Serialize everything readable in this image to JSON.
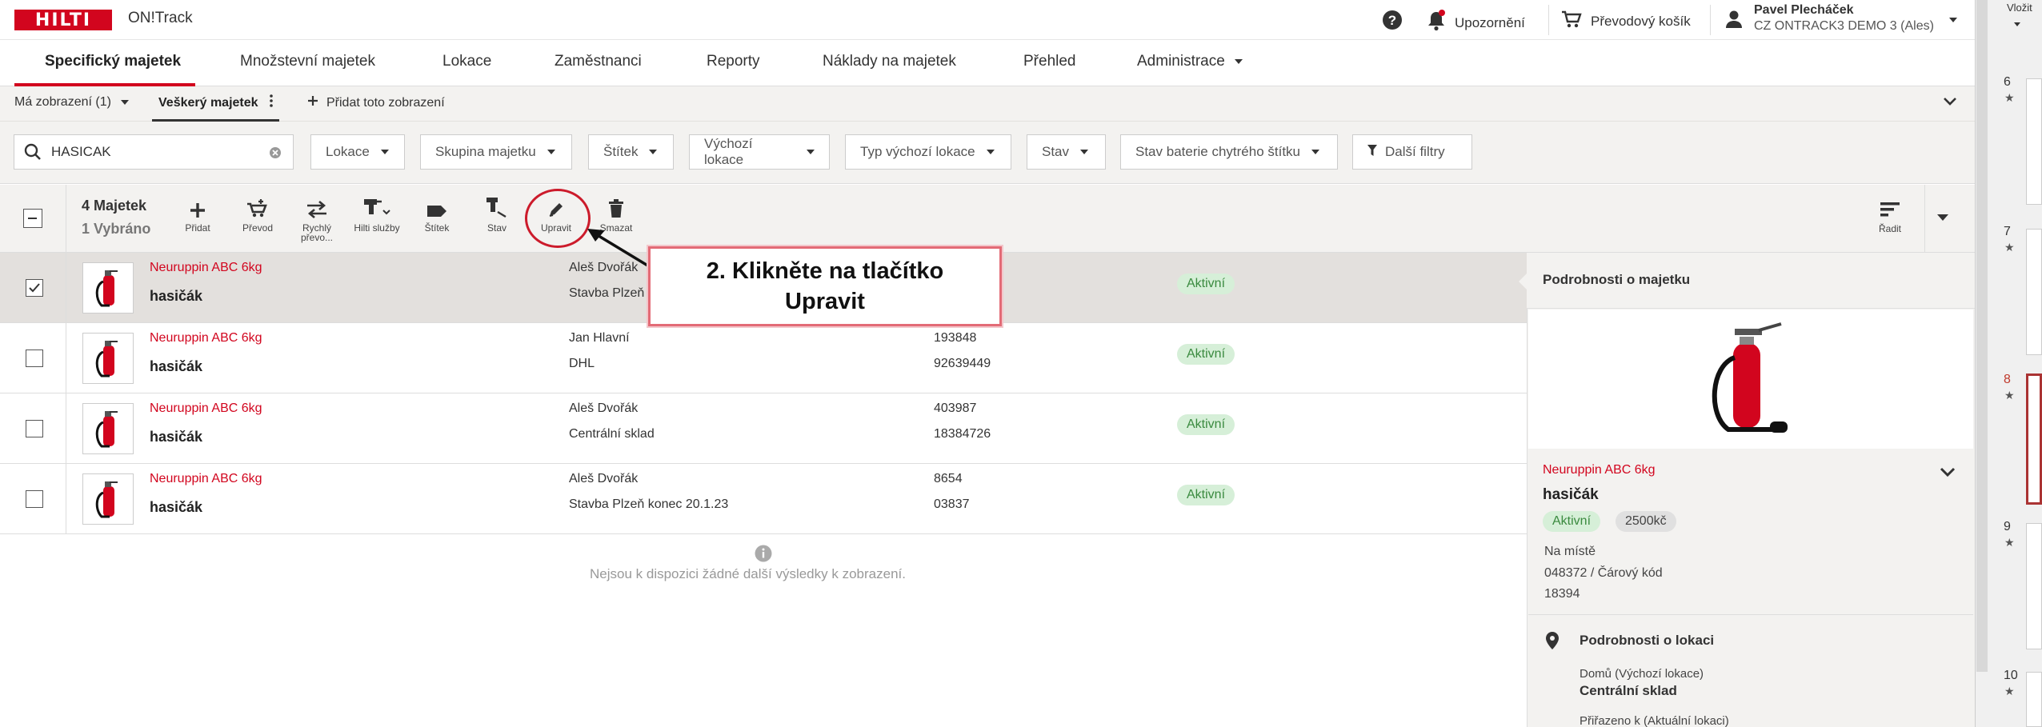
{
  "header": {
    "app_name": "ON!Track",
    "brand": "HILTI",
    "help_label": "?",
    "notifications_label": "Upozornění",
    "cart_label": "Převodový košík",
    "user_name": "Pavel Plecháček",
    "user_company": "CZ ONTRACK3 DEMO 3 (Ales)",
    "paste_label": "Vložit"
  },
  "nav": {
    "tabs": [
      {
        "label": "Specifický majetek"
      },
      {
        "label": "Množstevní majetek"
      },
      {
        "label": "Lokace"
      },
      {
        "label": "Zaměstnanci"
      },
      {
        "label": "Reporty"
      },
      {
        "label": "Náklady na majetek"
      },
      {
        "label": "Přehled"
      },
      {
        "label": "Administrace"
      }
    ]
  },
  "views": {
    "my_views": "Má zobrazení (1)",
    "all_assets": "Veškerý majetek",
    "add_view": "Přidat toto zobrazení"
  },
  "filters": {
    "search_value": "HASICAK",
    "items": [
      "Lokace",
      "Skupina majetku",
      "Štítek",
      "Výchozí lokace",
      "Typ výchozí lokace",
      "Stav",
      "Stav baterie chytrého štítku",
      "Další filtry"
    ]
  },
  "toolbar": {
    "count": "4 Majetek",
    "selected": "1 Vybráno",
    "actions": {
      "add": "Přidat",
      "transfer": "Převod",
      "quick_transfer_1": "Rychlý",
      "quick_transfer_2": "převo...",
      "hilti_services": "Hilti služby",
      "label": "Štítek",
      "status": "Stav",
      "edit": "Upravit",
      "delete": "Smazat",
      "sort": "Řadit"
    }
  },
  "rows": [
    {
      "model": "Neuruppin ABC 6kg",
      "name": "hasičák",
      "owner": "Aleš Dvořák",
      "location": "Stavba Plzeň",
      "inv": "",
      "code": "",
      "status": "Aktivní"
    },
    {
      "model": "Neuruppin ABC 6kg",
      "name": "hasičák",
      "owner": "Jan Hlavní",
      "location": "DHL",
      "inv": "193848",
      "code": "92639449",
      "status": "Aktivní"
    },
    {
      "model": "Neuruppin ABC 6kg",
      "name": "hasičák",
      "owner": "Aleš Dvořák",
      "location": "Centrální sklad",
      "inv": "403987",
      "code": "18384726",
      "status": "Aktivní"
    },
    {
      "model": "Neuruppin ABC 6kg",
      "name": "hasičák",
      "owner": "Aleš Dvořák",
      "location": "Stavba Plzeň konec 20.1.23",
      "inv": "8654",
      "code": "03837",
      "status": "Aktivní"
    }
  ],
  "no_more": "Nejsou k dispozici žádné další výsledky k zobrazení.",
  "details": {
    "title": "Podrobnosti o majetku",
    "model": "Neuruppin ABC 6kg",
    "name": "hasičák",
    "status": "Aktivní",
    "price": "2500kč",
    "on_site": "Na místě",
    "barcode_line": "048372 / Čárový kód",
    "barcode_value": "18394",
    "location_title": "Podrobnosti o lokaci",
    "home_label": "Domů (Výchozí lokace)",
    "home_value": "Centrální sklad",
    "assigned_label": "Přiřazeno k (Aktuální lokaci)"
  },
  "callout": {
    "line1": "2. Klikněte na tlačítko",
    "line2": "Upravit"
  },
  "slides": {
    "numbers": [
      "6",
      "7",
      "8",
      "9",
      "10"
    ],
    "star": "★"
  }
}
